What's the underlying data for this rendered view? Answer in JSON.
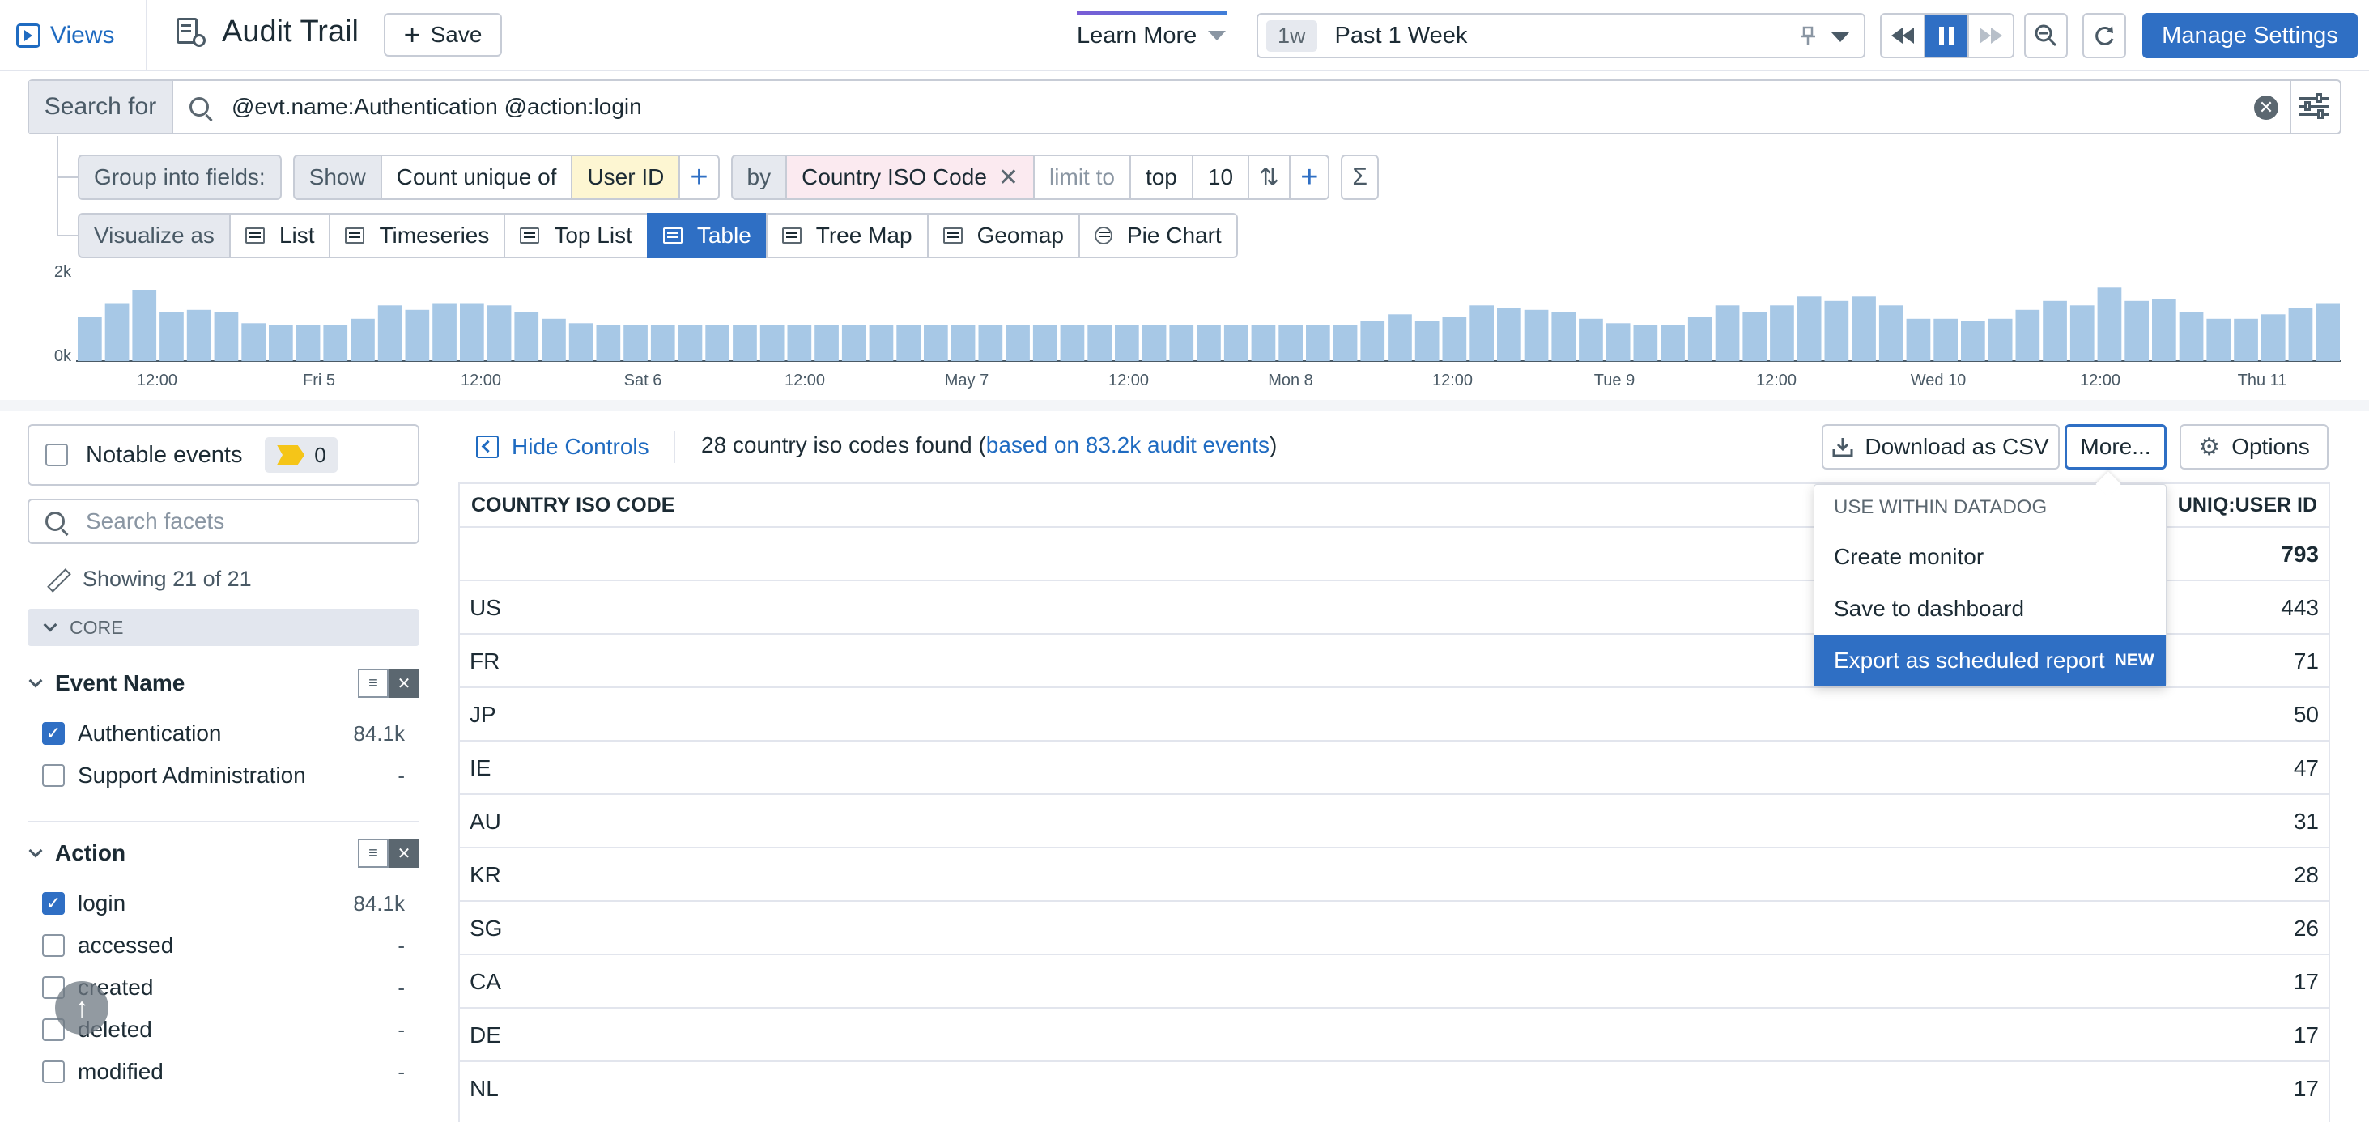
{
  "topbar": {
    "views_label": "Views",
    "title": "Audit Trail",
    "save_label": "Save",
    "learn_more_label": "Learn More",
    "time_short": "1w",
    "time_label": "Past 1 Week",
    "manage_settings_label": "Manage Settings",
    "icons": [
      "views-icon",
      "audit-trail-icon",
      "plus-icon",
      "chevron-down-icon",
      "pin-icon",
      "rewind-icon",
      "pause-icon",
      "fast-forward-icon",
      "zoom-out-icon",
      "refresh-icon"
    ],
    "accent_color": "#2f6fc4"
  },
  "search": {
    "prefix_label": "Search for",
    "query": "@evt.name:Authentication @action:login"
  },
  "query_builder": {
    "group_label": "Group into fields:",
    "show_label": "Show",
    "measure_label": "Count unique of",
    "measure_field": "User ID",
    "by_label": "by",
    "group_field": "Country ISO Code",
    "limit_label": "limit to",
    "limit_order": "top",
    "limit_value": "10",
    "visualize_label": "Visualize as",
    "viz_options": [
      "List",
      "Timeseries",
      "Top List",
      "Table",
      "Tree Map",
      "Geomap",
      "Pie Chart"
    ],
    "selected_viz": "Table"
  },
  "histogram": {
    "ytick_top": "2k",
    "ytick_bottom": "0k",
    "xticks": [
      "12:00",
      "Fri 5",
      "12:00",
      "Sat 6",
      "12:00",
      "May 7",
      "12:00",
      "Mon 8",
      "12:00",
      "Tue 9",
      "12:00",
      "Wed 10",
      "12:00",
      "Thu 11"
    ],
    "ymax": 2000,
    "values": [
      1000,
      1300,
      1600,
      1100,
      1150,
      1100,
      850,
      800,
      800,
      800,
      950,
      1250,
      1150,
      1300,
      1300,
      1250,
      1100,
      950,
      850,
      800,
      800,
      800,
      800,
      800,
      800,
      800,
      800,
      800,
      800,
      800,
      800,
      800,
      800,
      800,
      800,
      800,
      800,
      800,
      800,
      800,
      800,
      800,
      800,
      800,
      800,
      800,
      800,
      900,
      1050,
      900,
      1000,
      1250,
      1200,
      1150,
      1100,
      950,
      850,
      800,
      800,
      1000,
      1250,
      1100,
      1250,
      1450,
      1350,
      1450,
      1250,
      950,
      950,
      900,
      950,
      1150,
      1350,
      1250,
      1650,
      1350,
      1400,
      1100,
      950,
      950,
      1050,
      1200,
      1300
    ],
    "bar_color": "#a7c8e6"
  },
  "left_panel": {
    "notable_label": "Notable events",
    "notable_count": "0",
    "facet_search_placeholder": "Search facets",
    "showing_label": "Showing 21 of 21",
    "core_label": "CORE",
    "event_name": {
      "title": "Event Name",
      "items": [
        {
          "label": "Authentication",
          "count": "84.1k",
          "checked": true
        },
        {
          "label": "Support Administration",
          "count": "-",
          "checked": false
        }
      ]
    },
    "action": {
      "title": "Action",
      "items": [
        {
          "label": "login",
          "count": "84.1k",
          "checked": true
        },
        {
          "label": "accessed",
          "count": "-",
          "checked": false
        },
        {
          "label": "created",
          "count": "-",
          "checked": false
        },
        {
          "label": "deleted",
          "count": "-",
          "checked": false
        },
        {
          "label": "modified",
          "count": "-",
          "checked": false
        }
      ]
    }
  },
  "results": {
    "hide_controls_label": "Hide Controls",
    "found_prefix": "28 country iso codes found (",
    "found_link": "based on 83.2k audit events",
    "found_suffix": ")",
    "download_label": "Download as CSV",
    "more_label": "More...",
    "options_label": "Options",
    "col_left": "COUNTRY ISO CODE",
    "col_right": "UNIQ:USER ID",
    "rows": [
      {
        "code": "",
        "value": "793"
      },
      {
        "code": "US",
        "value": "443"
      },
      {
        "code": "FR",
        "value": "71"
      },
      {
        "code": "JP",
        "value": "50"
      },
      {
        "code": "IE",
        "value": "47"
      },
      {
        "code": "AU",
        "value": "31"
      },
      {
        "code": "KR",
        "value": "28"
      },
      {
        "code": "SG",
        "value": "26"
      },
      {
        "code": "CA",
        "value": "17"
      },
      {
        "code": "DE",
        "value": "17"
      },
      {
        "code": "NL",
        "value": "17"
      }
    ]
  },
  "more_menu": {
    "heading": "USE WITHIN DATADOG",
    "items": [
      "Create monitor",
      "Save to dashboard",
      "Export as scheduled report"
    ],
    "new_badge": "NEW"
  }
}
